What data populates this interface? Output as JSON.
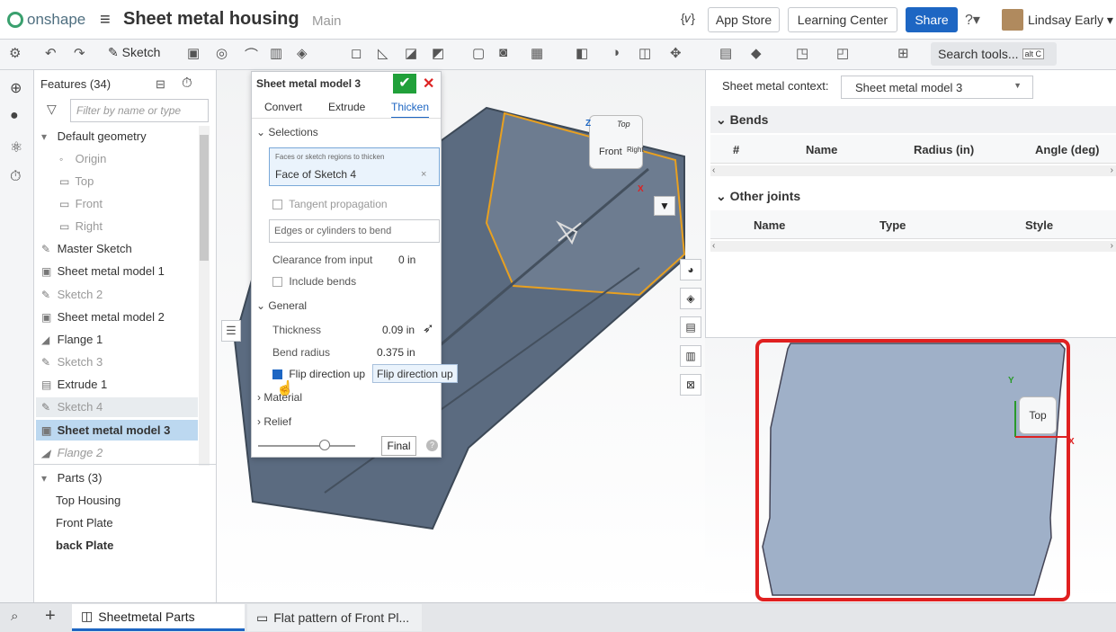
{
  "header": {
    "logo_text": "onshape",
    "doc_title": "Sheet metal housing",
    "branch": "Main",
    "variable_icon": "{𝑣}",
    "app_store": "App Store",
    "learning_center": "Learning Center",
    "share": "Share",
    "help": "?▾",
    "user": "Lindsay Early ▾"
  },
  "toolbar": {
    "undo": "↶",
    "redo": "↷",
    "sketch_label": "Sketch",
    "search_label": "Search tools...",
    "shortcut": "alt C"
  },
  "features": {
    "title": "Features (34)",
    "filter_placeholder": "Filter by name or type",
    "items": [
      {
        "label": "Default geometry",
        "icon": "▾"
      },
      {
        "label": "Origin",
        "icon": "◦"
      },
      {
        "label": "Top",
        "icon": "▭"
      },
      {
        "label": "Front",
        "icon": "▭"
      },
      {
        "label": "Right",
        "icon": "▭"
      },
      {
        "label": "Master Sketch",
        "icon": "✎"
      },
      {
        "label": "Sheet metal model 1",
        "icon": "▣"
      },
      {
        "label": "Sketch 2",
        "icon": "✎"
      },
      {
        "label": "Sheet metal model 2",
        "icon": "▣"
      },
      {
        "label": "Flange 1",
        "icon": "◢"
      },
      {
        "label": "Sketch 3",
        "icon": "✎"
      },
      {
        "label": "Extrude 1",
        "icon": "▤"
      },
      {
        "label": "Sketch 4",
        "icon": "✎"
      },
      {
        "label": "Sheet metal model 3",
        "icon": "▣"
      },
      {
        "label": "Flange 2",
        "icon": "◢"
      }
    ],
    "parts_title": "Parts (3)",
    "parts": [
      "Top Housing",
      "Front Plate",
      "back Plate"
    ]
  },
  "dialog": {
    "title": "Sheet metal model 3",
    "ok": "✔",
    "cancel": "✕",
    "tabs": [
      "Convert",
      "Extrude",
      "Thicken"
    ],
    "selections_label": "Selections",
    "faces_hint": "Faces or sketch regions to thicken",
    "faces_value": "Face of Sketch 4",
    "clear_x": "×",
    "tangent_label": "Tangent propagation",
    "edges_placeholder": "Edges or cylinders to bend",
    "clearance_label": "Clearance from input",
    "clearance_value": "0 in",
    "include_bends": "Include bends",
    "general_label": "General",
    "thickness_label": "Thickness",
    "thickness_value": "0.09 in",
    "bend_radius_label": "Bend radius",
    "bend_radius_value": "0.375 in",
    "flip_label": "Flip direction up",
    "flip_checked": true,
    "tooltip": "Flip direction up",
    "material_label": "Material",
    "relief_label": "Relief",
    "final_label": "Final",
    "help_icon": "?"
  },
  "viewcube": {
    "top": "Top",
    "front": "Front",
    "right": "Right",
    "z": "Z",
    "x": "X",
    "y": "Y"
  },
  "right_panel": {
    "context_label": "Sheet metal context:",
    "context_value": "Sheet metal model 3",
    "bends_title": "Bends",
    "bends_columns": [
      "#",
      "Name",
      "Radius (in)",
      "Angle (deg)"
    ],
    "joints_title": "Other joints",
    "joints_columns": [
      "Name",
      "Type",
      "Style"
    ],
    "flat_viewcube": "Top"
  },
  "bottom_tabs": {
    "add": "+",
    "tab1": "Sheetmetal Parts",
    "tab2": "Flat pattern of Front Pl..."
  },
  "colors": {
    "accent": "#1d66c3",
    "ok_green": "#21a03a",
    "highlight_red": "#e02020",
    "part_fill": "#5b6b80",
    "selection_edge": "#e8a020"
  }
}
